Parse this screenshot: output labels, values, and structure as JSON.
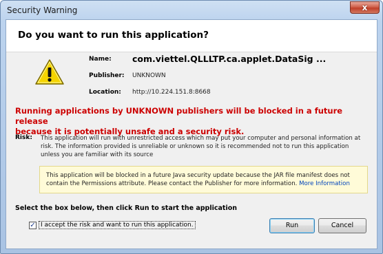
{
  "window": {
    "title": "Security Warning",
    "close_label": "x"
  },
  "header": {
    "question": "Do you want to run this application?"
  },
  "details": {
    "name_label": "Name:",
    "name_value": "com.viettel.QLLLTP.ca.applet.DataSig ...",
    "publisher_label": "Publisher:",
    "publisher_value": "UNKNOWN",
    "location_label": "Location:",
    "location_value": "http://10.224.151.8:8668"
  },
  "warning": {
    "line1": "Running applications by UNKNOWN publishers will be blocked in a future release",
    "line2": "because it is potentially unsafe and a security risk."
  },
  "risk": {
    "label": "Risk:",
    "text": "This application will run with unrestricted access which may put your computer and personal information at risk. The information provided is unreliable or unknown so it is recommended not to run this application unless you are familiar with its source"
  },
  "notice": {
    "text": "This application will be blocked in a future Java security update because the JAR file manifest does not contain the Permissions attribute. Please contact the Publisher for more information.",
    "link": "More Information"
  },
  "instruction": "Select the box below, then click Run to start the application",
  "accept": {
    "label": "I accept the risk and want to run this application.",
    "checked": true
  },
  "buttons": {
    "run": "Run",
    "cancel": "Cancel"
  },
  "icons": {
    "warning": "warning-triangle-icon",
    "warning_color": "#f5d400"
  }
}
